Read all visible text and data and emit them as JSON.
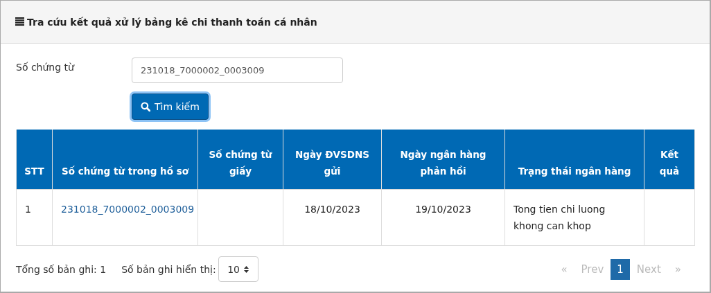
{
  "panel": {
    "title": "Tra cứu kết quả xử lý bảng kê chi thanh toán cá nhân"
  },
  "search": {
    "label": "Số chứng từ",
    "value": "231018_7000002_0003009",
    "button": "Tìm kiếm"
  },
  "table": {
    "columns": [
      "STT",
      "Số chứng từ trong hồ sơ",
      "Số chứng từ giấy",
      "Ngày ĐVSDNS gửi",
      "Ngày ngân hàng phản hồi",
      "Trạng thái ngân hàng",
      "Kết quả"
    ],
    "rows": [
      {
        "cells": [
          {
            "kind": "text",
            "text": "1"
          },
          {
            "kind": "link",
            "text": "231018_7000002_0003009"
          },
          {
            "kind": "text",
            "text": ""
          },
          {
            "kind": "text",
            "text": "18/10/2023"
          },
          {
            "kind": "text",
            "text": "19/10/2023"
          },
          {
            "kind": "text",
            "text": "Tong tien chi luong khong can khop"
          },
          {
            "kind": "text",
            "text": ""
          }
        ]
      }
    ]
  },
  "footer": {
    "total": "Tổng số bản ghi: 1",
    "page_size_label": "Số bản ghi hiển thị:",
    "page_size": "10"
  },
  "pagination": [
    {
      "label": "«",
      "selected": false,
      "disabled": true
    },
    {
      "label": "Prev",
      "selected": false,
      "disabled": true
    },
    {
      "label": "1",
      "selected": true,
      "disabled": false
    },
    {
      "label": "Next",
      "selected": false,
      "disabled": true
    },
    {
      "label": "»",
      "selected": false,
      "disabled": true
    }
  ]
}
